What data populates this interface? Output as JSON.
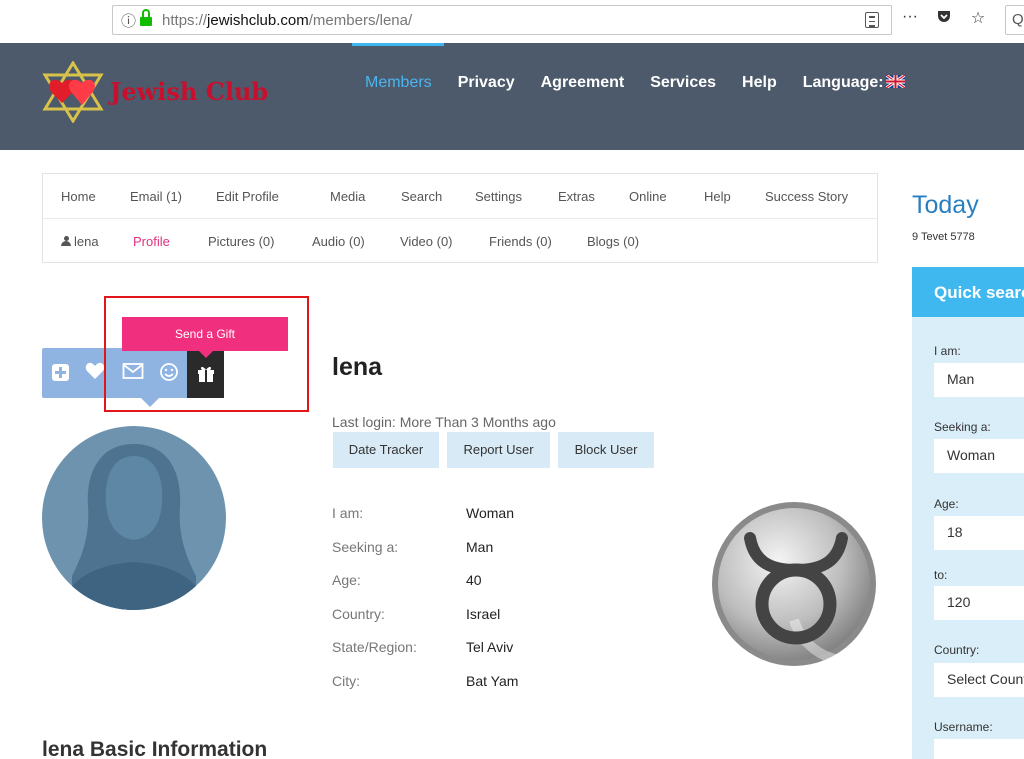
{
  "browser": {
    "url_prefix": "https://",
    "url_domain": "jewishclub.com",
    "url_path": "/members/lena/",
    "more_icon": "···"
  },
  "header": {
    "logo_text": "Jewish Club",
    "nav": [
      "Members",
      "Privacy",
      "Agreement",
      "Services",
      "Help",
      "Language:"
    ],
    "colors": {
      "background": "#4c5a6b",
      "active": "#4ab6f0",
      "logo": "#c8102e"
    }
  },
  "subnav": {
    "row1": [
      "Home",
      "Email (1)",
      "Edit Profile",
      "Media",
      "Search",
      "Settings",
      "Extras",
      "Online",
      "Help",
      "Success Story"
    ],
    "row2": [
      "lena",
      "Profile",
      "Pictures (0)",
      "Audio (0)",
      "Video (0)",
      "Friends (0)",
      "Blogs (0)"
    ]
  },
  "sidebar": {
    "today_title": "Today",
    "today_date": "9 Tevet 5778",
    "quick_search_title": "Quick search",
    "fields": [
      {
        "label": "I am:",
        "value": "Man"
      },
      {
        "label": "Seeking a:",
        "value": "Woman"
      },
      {
        "label": "Age:",
        "value": "18"
      },
      {
        "label": "to:",
        "value": "120"
      },
      {
        "label": "Country:",
        "value": "Select Country"
      },
      {
        "label": "Username:",
        "value": ""
      }
    ]
  },
  "actions": {
    "tooltip": "Send a Gift",
    "icons": [
      "add-icon",
      "heart-icon",
      "mail-icon",
      "smile-icon",
      "gift-icon"
    ]
  },
  "profile": {
    "name": "lena",
    "last_login": "Last login: More Than 3 Months ago",
    "buttons": [
      "Date Tracker",
      "Report User",
      "Block User"
    ],
    "info": [
      {
        "label": "I am:",
        "value": "Woman"
      },
      {
        "label": "Seeking a:",
        "value": "Man"
      },
      {
        "label": "Age:",
        "value": "40"
      },
      {
        "label": "Country:",
        "value": "Israel"
      },
      {
        "label": "State/Region:",
        "value": "Tel Aviv"
      },
      {
        "label": "City:",
        "value": "Bat Yam"
      }
    ],
    "zodiac_icon": "taurus-icon",
    "basic_info_title": "lena Basic Information"
  }
}
